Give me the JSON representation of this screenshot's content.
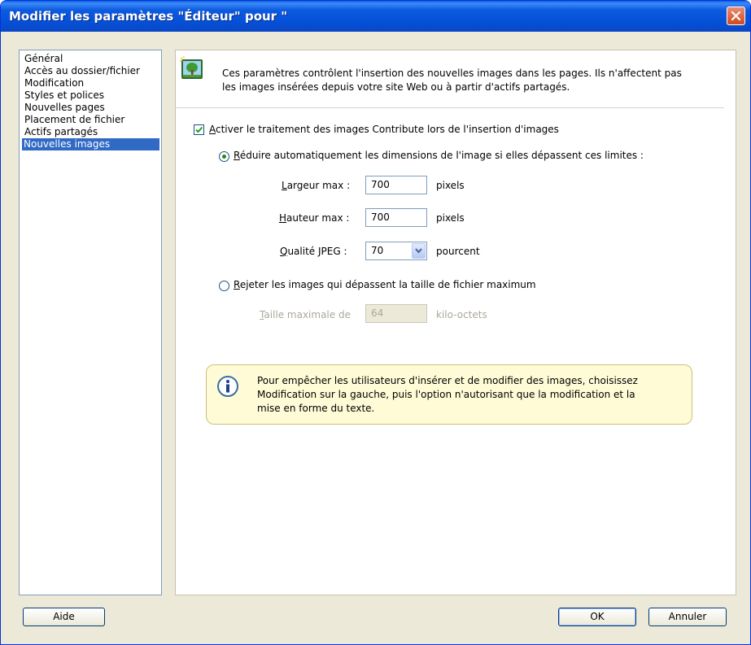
{
  "window": {
    "title": "Modifier les paramètres \"Éditeur\" pour \""
  },
  "sidebar": {
    "items": [
      {
        "label": "Général",
        "selected": false
      },
      {
        "label": "Accès au dossier/fichier",
        "selected": false
      },
      {
        "label": "Modification",
        "selected": false
      },
      {
        "label": "Styles et polices",
        "selected": false
      },
      {
        "label": "Nouvelles pages",
        "selected": false
      },
      {
        "label": "Placement de fichier",
        "selected": false
      },
      {
        "label": "Actifs partagés",
        "selected": false
      },
      {
        "label": "Nouvelles images",
        "selected": true
      }
    ]
  },
  "intro": {
    "line1": "Ces paramètres contrôlent l'insertion des nouvelles images dans les pages. Ils n'affectent pas",
    "line2": "les images insérées depuis votre site Web ou à partir d'actifs partagés."
  },
  "enable_processing": {
    "checked": true,
    "label_first": "A",
    "label_rest": "ctiver le traitement des images Contribute lors de l'insertion d'images"
  },
  "reduce_option": {
    "selected": true,
    "label_first": "R",
    "label_rest": "éduire automatiquement les dimensions de l'image si elles dépassent ces limites :"
  },
  "max_width": {
    "label_first": "L",
    "label_rest": "argeur max :",
    "value": "700",
    "unit": "pixels"
  },
  "max_height": {
    "label_first": "H",
    "label_rest": "auteur max :",
    "value": "700",
    "unit": "pixels"
  },
  "jpeg_quality": {
    "label_first": "Q",
    "label_rest": "ualité JPEG :",
    "value": "70",
    "unit": "pourcent"
  },
  "reject_option": {
    "selected": false,
    "label_first": "R",
    "label_rest": "ejeter les images qui dépassent la taille de fichier maximum"
  },
  "max_file_size": {
    "label_first": "T",
    "label_rest": "aille maximale de",
    "value": "64",
    "unit": "kilo-octets"
  },
  "info": {
    "line1": "Pour empêcher les utilisateurs d'insérer et de modifier des images, choisissez",
    "line2": "Modification sur la gauche, puis l'option n'autorisant que la modification et la",
    "line3": "mise en forme du texte."
  },
  "buttons": {
    "help": "Aide",
    "ok": "OK",
    "cancel": "Annuler"
  },
  "colors": {
    "titlebar": "#0550d8",
    "selection": "#316ac5",
    "info_bg": "#fffbd6"
  }
}
